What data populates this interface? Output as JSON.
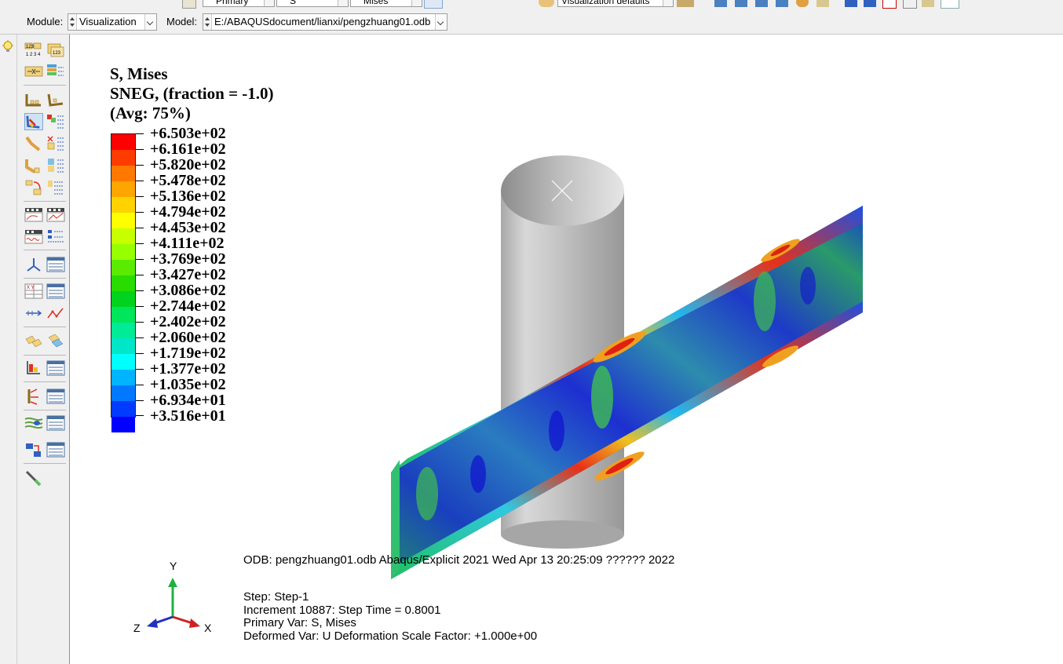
{
  "top_toolbar": {
    "step_combo": "Primary",
    "field_combo": "S",
    "output_combo": "Mises",
    "render_combo": "Visualization defaults"
  },
  "context_bar": {
    "module_label": "Module:",
    "module_value": "Visualization",
    "model_label": "Model:",
    "model_value": "E:/ABAQUSdocument/lianxi/pengzhuang01.odb"
  },
  "legend": {
    "title_lines": [
      "S, Mises",
      "SNEG, (fraction = -1.0)",
      "(Avg: 75%)"
    ],
    "values": [
      "+6.503e+02",
      "+6.161e+02",
      "+5.820e+02",
      "+5.478e+02",
      "+5.136e+02",
      "+4.794e+02",
      "+4.453e+02",
      "+4.111e+02",
      "+3.769e+02",
      "+3.427e+02",
      "+3.086e+02",
      "+2.744e+02",
      "+2.402e+02",
      "+2.060e+02",
      "+1.719e+02",
      "+1.377e+02",
      "+1.035e+02",
      "+6.934e+01",
      "+3.516e+01"
    ],
    "colors": [
      "#ff0000",
      "#ff3c00",
      "#ff7800",
      "#ffa500",
      "#ffd200",
      "#ffff00",
      "#c8ff00",
      "#96ff00",
      "#5aeb00",
      "#28dc00",
      "#00d21e",
      "#00e65a",
      "#00eb96",
      "#00e6c8",
      "#00ffff",
      "#00b4ff",
      "#0078ff",
      "#003cff",
      "#0000ff"
    ]
  },
  "info": {
    "odb_line": "ODB: pengzhuang01.odb    Abaqus/Explicit 2021    Wed Apr 13 20:25:09 ?????? 2022",
    "step_line": "Step: Step-1",
    "increment_line": "Increment     10887: Step Time =    0.8001",
    "primary_var_line": "Primary Var: S, Mises",
    "deformed_var_line": "Deformed Var: U   Deformation Scale Factor: +1.000e+00"
  },
  "triad": {
    "x": "X",
    "y": "Y",
    "z": "Z"
  },
  "colors": {
    "cylinder": "#bdbdbd",
    "viewport_bg": "#ffffff"
  }
}
